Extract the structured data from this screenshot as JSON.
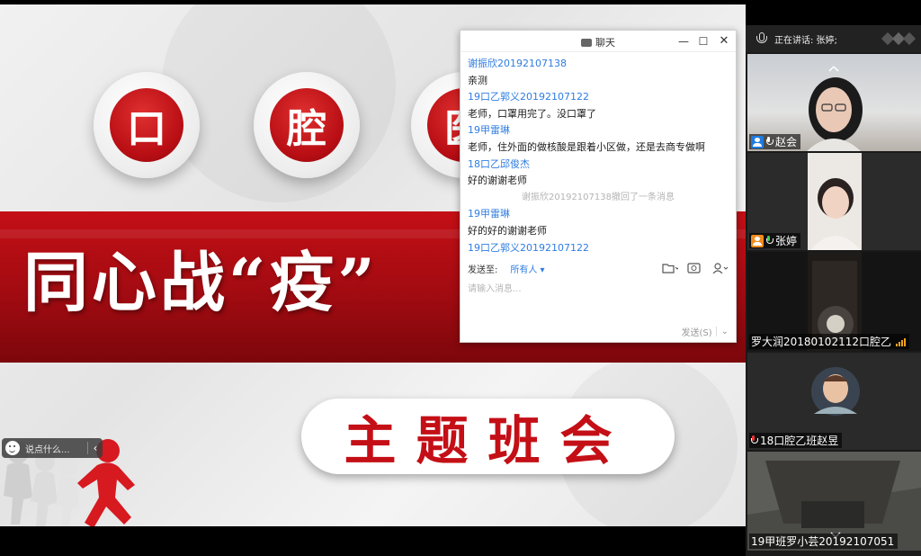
{
  "slide": {
    "chars": [
      "口",
      "腔",
      "医"
    ],
    "slogan": "同心战“疫”",
    "theme": "主题班会",
    "comment_placeholder": "说点什么..."
  },
  "chat": {
    "title": "聊天",
    "messages": [
      {
        "type": "sender",
        "text": "谢振欣20192107138"
      },
      {
        "type": "body",
        "text": "亲测"
      },
      {
        "type": "sender",
        "text": "19口乙郭义20192107122"
      },
      {
        "type": "body",
        "text": "老师，口罩用完了。没口罩了"
      },
      {
        "type": "sender",
        "text": "19甲雷琳"
      },
      {
        "type": "body",
        "text": "老师，住外面的做核酸是跟着小区做，还是去商专做啊"
      },
      {
        "type": "sender",
        "text": "18口乙邱俊杰"
      },
      {
        "type": "body",
        "text": "好的谢谢老师"
      },
      {
        "type": "sys",
        "text": "谢振欣20192107138撤回了一条消息"
      },
      {
        "type": "sender",
        "text": "19甲雷琳"
      },
      {
        "type": "body",
        "text": "好的好的谢谢老师"
      },
      {
        "type": "sender",
        "text": "19口乙郭义20192107122"
      }
    ],
    "send_to_label": "发送至:",
    "send_to_value": "所有人",
    "input_placeholder": "请输入消息...",
    "send_button": "发送(S)"
  },
  "panel": {
    "speaking": "正在讲话: 张婷;",
    "participants": [
      {
        "name": "赵会"
      },
      {
        "name": "张婷"
      },
      {
        "name": "罗大润20180102112口腔乙"
      },
      {
        "name": "18口腔乙班赵昱"
      },
      {
        "name": "19甲班罗小芸20192107051"
      }
    ]
  },
  "colors": {
    "accent_red": "#c40f16",
    "link_blue": "#2f7de1",
    "badge_blue": "#1e7be0",
    "badge_orange": "#f08c1c"
  }
}
